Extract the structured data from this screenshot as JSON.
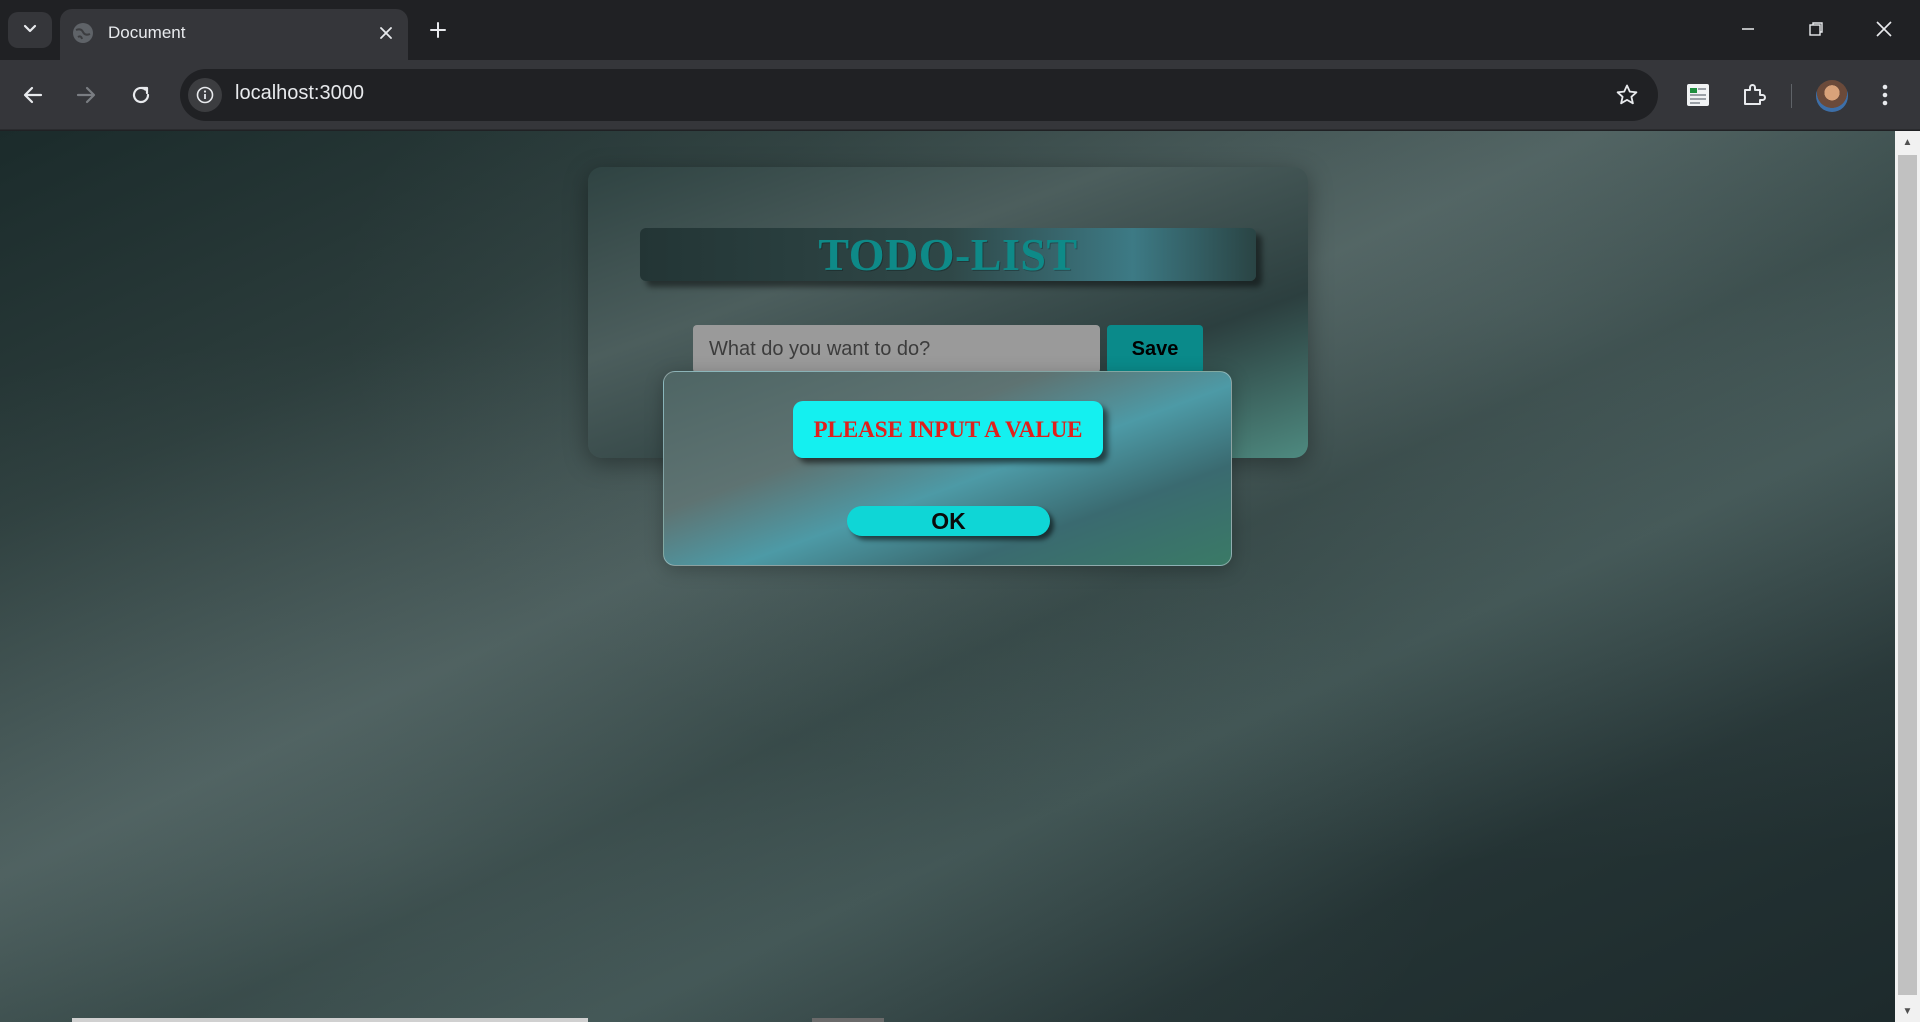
{
  "browser": {
    "tab_title": "Document",
    "url": "localhost:3000"
  },
  "app": {
    "title": "TODO-LIST",
    "input": {
      "placeholder": "What do you want to do?",
      "value": ""
    },
    "save_label": "Save"
  },
  "alert": {
    "message": "PLEASE INPUT A VALUE",
    "ok_label": "OK"
  },
  "colors": {
    "title_text": "#0e8a88",
    "save_button": "#0a8a8a",
    "alert_background": "#14f0f0",
    "alert_text": "#e0201c",
    "ok_button": "#0fd6d6"
  }
}
